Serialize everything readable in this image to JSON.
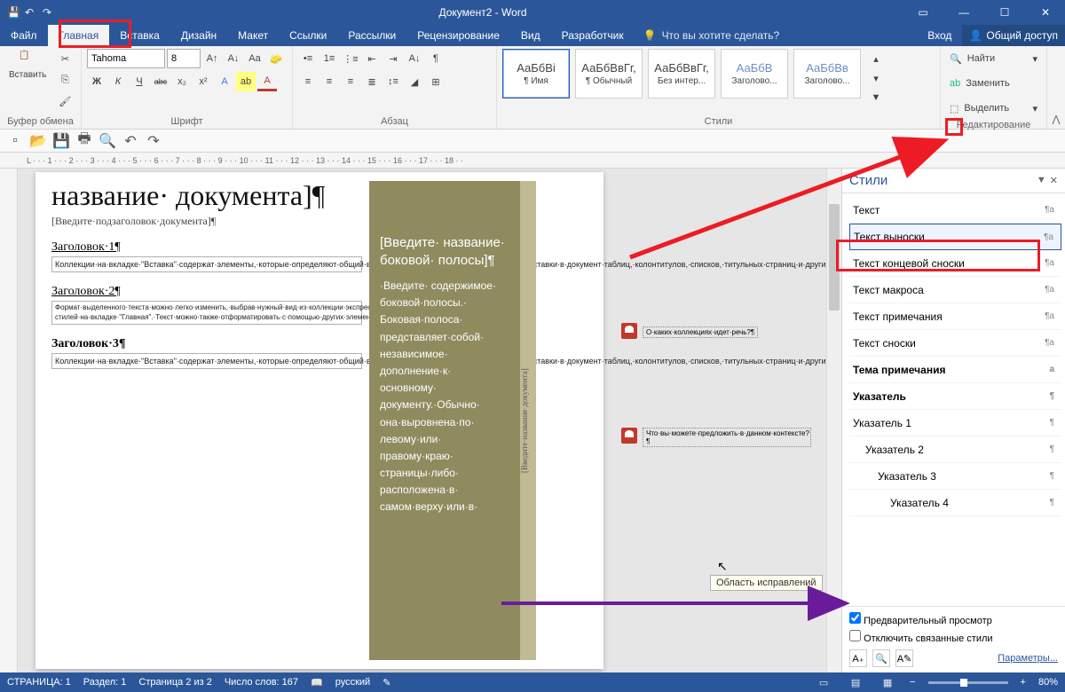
{
  "titlebar": {
    "title": "Документ2 - Word"
  },
  "tabs": [
    "Файл",
    "Главная",
    "Вставка",
    "Дизайн",
    "Макет",
    "Ссылки",
    "Рассылки",
    "Рецензирование",
    "Вид",
    "Разработчик"
  ],
  "active_tab_index": 1,
  "tellme": "Что вы хотите сделать?",
  "signin": "Вход",
  "share": "Общий доступ",
  "ribbon": {
    "clipboard": {
      "label": "Буфер обмена",
      "paste": "Вставить"
    },
    "font": {
      "label": "Шрифт",
      "name": "Tahoma",
      "size": "8",
      "buttons_row1": [
        "A↑",
        "A↓",
        "Aa",
        "🧹"
      ],
      "buttons_row2": [
        "Ж",
        "К",
        "Ч",
        "abc",
        "x₂",
        "x²",
        "A",
        "A"
      ]
    },
    "paragraph": {
      "label": "Абзац"
    },
    "styles": {
      "label": "Стили",
      "items": [
        {
          "preview": "АаБбВі",
          "name": "¶ Имя"
        },
        {
          "preview": "АаБбВвГг,",
          "name": "¶ Обычный"
        },
        {
          "preview": "АаБбВвГг,",
          "name": "Без интер..."
        },
        {
          "preview": "АаБбВ",
          "name": "Заголово..."
        },
        {
          "preview": "АаБбВв",
          "name": "Заголово..."
        }
      ]
    },
    "editing": {
      "label": "Редактирование",
      "find": "Найти",
      "replace": "Заменить",
      "select": "Выделить"
    }
  },
  "ruler": "L · · · 1 · · · 2 · · · 3 · · · 4 · · · 5 · · · 6 · · · 7 · · · 8 · · · 9 · · · 10 · · · 11 · · · 12 · · · 13 · · · 14 · · · 15 · · · 16 · · · 17 · · · 18 · ·",
  "document": {
    "title": "название· документа]¶",
    "subtitle": "[Введите·подзаголовок·документа]¶",
    "sections": [
      {
        "h": "Заголовок·1¶",
        "p": "Коллекции·на·вкладке·\"Вставка\"·содержат·элементы,·которые·определяют·общий·вид·документа.·Эти·коллекции·служат·для·вставки·в·документ·таблиц,·колонтитулов,·списков,·титульных·страниц·и·других·стандартных·блоков.¶"
      },
      {
        "h": "Заголовок·2¶",
        "p": "Формат·выделенного·текста·можно·легко·изменить,·выбрав·нужный·вид·из·коллекции·экспресс-стилей·на·вкладке·\"Главная\".·Текст·можно·также·отформатировать·с·помощью·других·элементов·управления·на·вкладке·\"Главная\".·¶"
      },
      {
        "h": "Заголовок·3¶",
        "p": "Коллекции·на·вкладке·\"Вставка\"·содержат·элементы,·которые·определяют·общий·вид·документа.·Эти·коллекции·служат·для·вставки·в·документ·таблиц,·колонтитулов,·списков,·титульных·страниц·и·других·стандартных·блоков.¶"
      }
    ],
    "sidebar_title": "[Введите· название· боковой· полосы]¶",
    "sidebar_body": "·Введите· содержимое· боковой·полосы.· Боковая·полоса· представляет·собой· независимое· дополнение·к· основному· документу.·Обычно· она·выровнена·по· левому·или· правому·краю· страницы·либо· расположена·в· самом·верху·или·в·",
    "sidebar_caption": "[Введите·название·документа]"
  },
  "comments": [
    "О·каких·коллекциях·идет·речь?¶",
    "Что·вы·можете·предложить·в·данном·контексте?¶"
  ],
  "tooltip": "Область исправлений",
  "stylespane": {
    "title": "Стили",
    "items": [
      {
        "label": "Текст",
        "mark": "¶a",
        "cls": ""
      },
      {
        "label": "Текст выноски",
        "mark": "¶a",
        "cls": "sel"
      },
      {
        "label": "Текст концевой сноски",
        "mark": "¶a",
        "cls": ""
      },
      {
        "label": "Текст  макроса",
        "mark": "¶a",
        "cls": ""
      },
      {
        "label": "Текст примечания",
        "mark": "¶a",
        "cls": ""
      },
      {
        "label": "Текст сноски",
        "mark": "¶a",
        "cls": ""
      },
      {
        "label": "Тема примечания",
        "mark": "a",
        "cls": "bold"
      },
      {
        "label": "Указатель",
        "mark": "¶",
        "cls": "bold"
      },
      {
        "label": "Указатель 1",
        "mark": "¶",
        "cls": ""
      },
      {
        "label": "Указатель 2",
        "mark": "¶",
        "cls": "indent1"
      },
      {
        "label": "Указатель 3",
        "mark": "¶",
        "cls": "indent2"
      },
      {
        "label": "Указатель 4",
        "mark": "¶",
        "cls": "indent3"
      }
    ],
    "preview_cb": "Предварительный просмотр",
    "disable_cb": "Отключить связанные стили",
    "options": "Параметры..."
  },
  "statusbar": {
    "page": "СТРАНИЦА: 1",
    "section": "Раздел: 1",
    "pageof": "Страница 2 из 2",
    "words": "Число слов: 167",
    "lang": "русский",
    "zoom": "80%"
  }
}
